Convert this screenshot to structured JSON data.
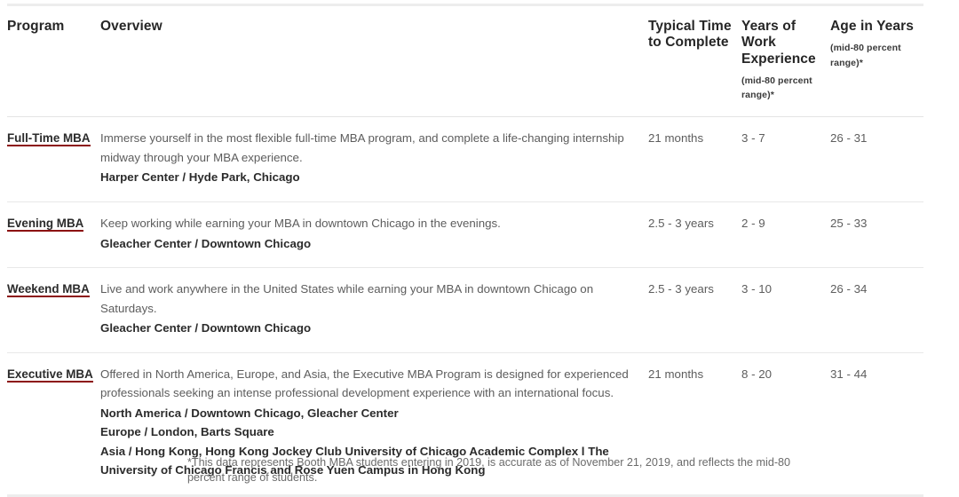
{
  "table": {
    "headers": {
      "program": "Program",
      "overview": "Overview",
      "typical_time": "Typical Time to Complete",
      "work_experience": "Years of Work Experience",
      "work_experience_sub": "(mid-80 percent range)*",
      "age": "Age in Years",
      "age_sub": "(mid-80 percent range)*"
    },
    "rows": [
      {
        "program": "Full-Time MBA",
        "description": "Immerse yourself in the most flexible full-time MBA program, and complete a life-changing internship midway through your MBA experience.",
        "locations": [
          "Harper Center / Hyde Park, Chicago"
        ],
        "typical_time": "21 months",
        "work_experience": "3 - 7",
        "age": "26 - 31"
      },
      {
        "program": "Evening MBA",
        "description": "Keep working while earning your MBA in downtown Chicago in the evenings.",
        "locations": [
          "Gleacher Center / Downtown Chicago"
        ],
        "typical_time": "2.5 - 3 years",
        "work_experience": "2 - 9",
        "age": "25 - 33"
      },
      {
        "program": "Weekend MBA",
        "description": "Live and work anywhere in the United States while earning your MBA in downtown Chicago on Saturdays.",
        "locations": [
          "Gleacher Center / Downtown Chicago"
        ],
        "typical_time": "2.5 - 3 years",
        "work_experience": "3 - 10",
        "age": "26 - 34"
      },
      {
        "program": "Executive MBA",
        "description": "Offered in North America, Europe, and Asia, the Executive MBA Program is designed for experienced professionals seeking an intense professional development experience with an international focus.",
        "locations": [
          "North America / Downtown Chicago, Gleacher Center",
          "Europe / London, Barts Square",
          "Asia / Hong Kong, Hong Kong Jockey Club University of Chicago Academic Complex l The University of Chicago Francis and Rose Yuen Campus in Hong Kong"
        ],
        "typical_time": "21 months",
        "work_experience": "8 - 20",
        "age": "31 - 44"
      }
    ]
  },
  "footnote": "*This data represents Booth MBA students entering in 2019, is accurate as of November 21, 2019, and reflects the mid-80 percent range of students.",
  "colors": {
    "link_underline": "#8c1010",
    "heading_text": "#262626",
    "body_text": "#5d5d5d",
    "rule": "#e8e8e8",
    "rule_heavy": "#ededed"
  }
}
